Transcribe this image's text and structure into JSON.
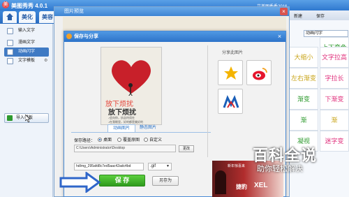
{
  "app": {
    "logo": "美",
    "title": "美图秀秀 4.0.1",
    "top_right": "艾美图秀秀2016"
  },
  "tabs": [
    {
      "label": "美化"
    },
    {
      "label": "美容"
    }
  ],
  "sidebar": {
    "items": [
      {
        "label": "输入文字"
      },
      {
        "label": "漫画文字"
      },
      {
        "label": "动画闪字"
      },
      {
        "label": "文字模板"
      }
    ],
    "import_label": "导入模板"
  },
  "right_panel": {
    "new_label": "新建",
    "save_label": "保存",
    "select_value": "动画闪字",
    "cells": [
      "上下变色",
      "大缩小",
      "文字拉高",
      "左右渐变",
      "字拉长",
      "渐变",
      "下渐变",
      "渐",
      "渐",
      "凝视",
      "迷字变"
    ],
    "cell_colors": [
      "#2e9a2e",
      "#c9a51a",
      "#e0307c",
      "#c9a51a",
      "#e0307c",
      "#2e9a2e",
      "#e0307c",
      "#2e9a2e",
      "#c9a51a",
      "#2e9a2e",
      "#e0307c"
    ]
  },
  "preview_window": {
    "title": "图片预览",
    "close": "×"
  },
  "save_dialog": {
    "title": "保存与分享",
    "close": "×",
    "image": {
      "text_big_red": "放下烦扰",
      "text_big_black": "放下烦扰",
      "caption_line1": "♪会向你，执念何须在",
      "caption_line2": "♪在我眼里，好的都是美好的"
    },
    "tab_animated": "动画图片",
    "tab_static": "静态图片",
    "save_path_label": "保存路径：",
    "options": [
      {
        "label": "桌面",
        "selected": true
      },
      {
        "label": "覆盖原图",
        "selected": false
      },
      {
        "label": "自定义",
        "selected": false
      }
    ],
    "path_value": "C:\\Users\\Administrator\\Desktop",
    "change_label": "更改",
    "filename_value": "hdImg_295afd8c7ed5aac42adc4bd",
    "format_value": ".gif",
    "save_label": "保 存",
    "save_as_label": "另存为",
    "share_label": "分享此图片",
    "ad_text1": "新年惊喜来",
    "ad_brand": "XEL",
    "ad_text2": "捷豹"
  },
  "watermark": {
    "line1": "百科全说",
    "line2": "助你轻松解决"
  },
  "colors": {
    "accent": "#2f78cf",
    "save_green": "#2e9a1d",
    "arrow_blue": "#2f66c9"
  }
}
